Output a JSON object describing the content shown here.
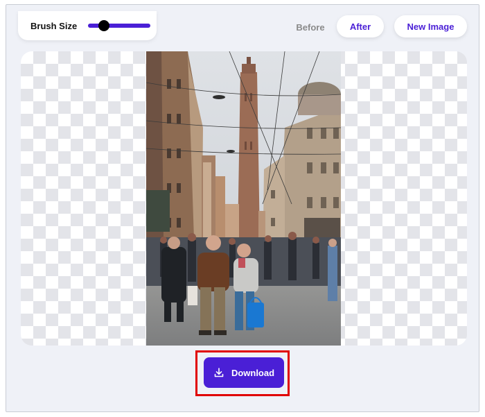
{
  "toolbar": {
    "brush_label": "Brush Size",
    "brush_size_fraction": 0.25,
    "before_label": "Before",
    "after_label": "After",
    "new_image_label": "New Image"
  },
  "actions": {
    "download_label": "Download"
  },
  "colors": {
    "accent": "#4a1fd6",
    "highlight": "#e00000"
  },
  "icons": {
    "download": "download-icon"
  }
}
